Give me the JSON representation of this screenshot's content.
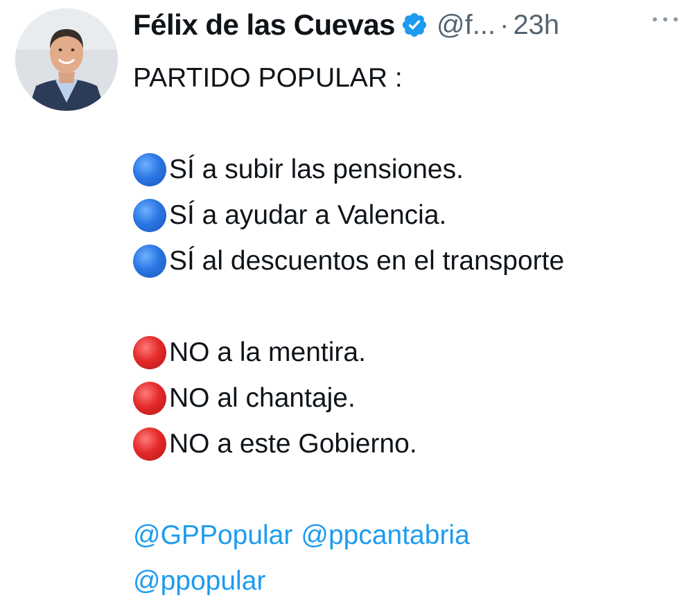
{
  "author": {
    "display_name": "Félix de las Cuevas",
    "handle": "@f...",
    "separator": "·",
    "time": "23h",
    "verified_icon": "verified-badge-icon",
    "avatar_icon": "avatar-photo"
  },
  "menu": {
    "icon": "more-options-icon"
  },
  "tweet": {
    "intro": "PARTIDO POPULAR :",
    "yes_items": [
      "SÍ a subir las pensiones.",
      "SÍ a ayudar a Valencia.",
      "SÍ al descuentos en el transporte"
    ],
    "no_items": [
      "NO a la mentira.",
      "NO al chantaje.",
      "NO a este Gobierno."
    ],
    "mentions": [
      "@GPPopular",
      "@ppcantabria",
      "@ppopular"
    ]
  },
  "colors": {
    "text": "#0f1419",
    "secondary": "#536471",
    "link": "#1d9bf0",
    "verified": "#1d9bf0",
    "yes_circle": "#2b77e4",
    "no_circle": "#e42b2b"
  }
}
